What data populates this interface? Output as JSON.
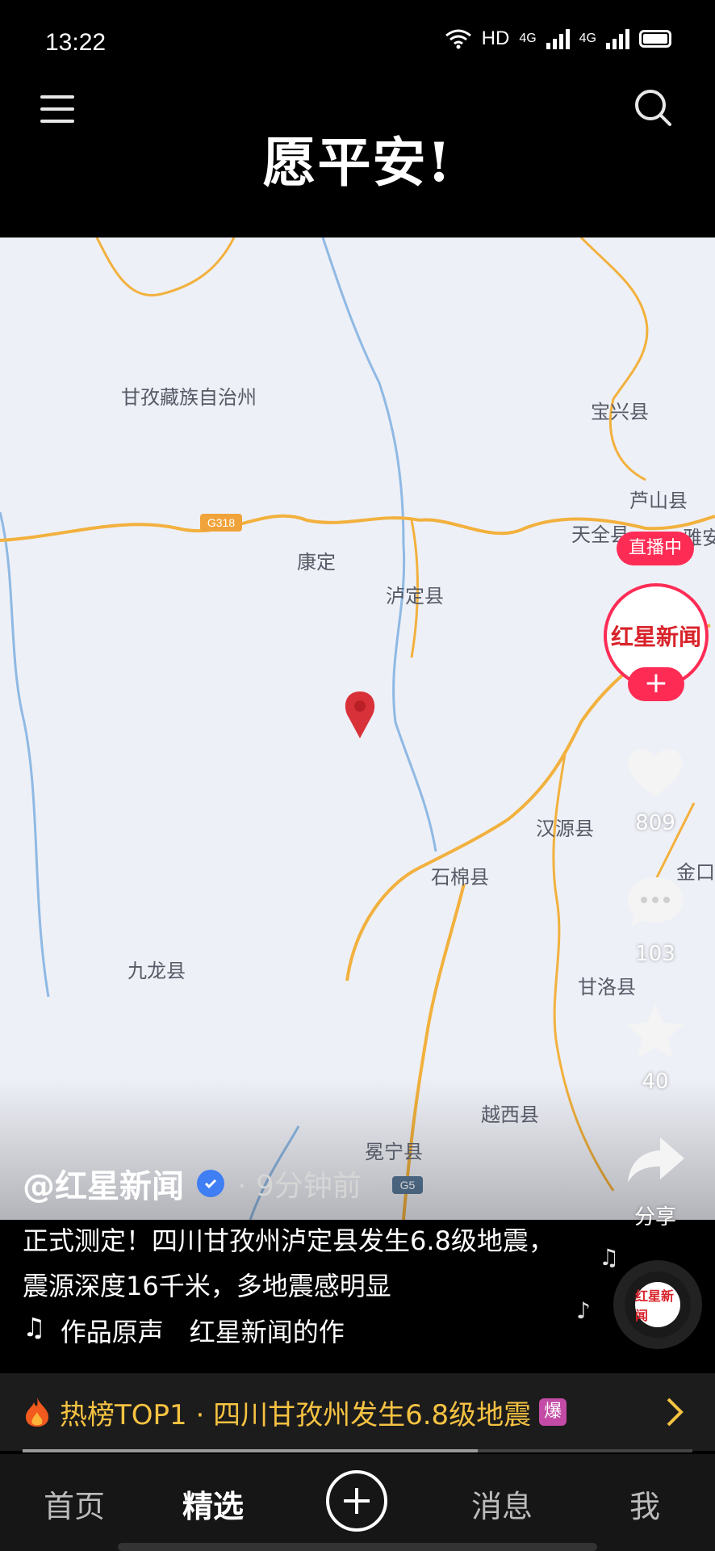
{
  "status_bar": {
    "time": "13:22",
    "network_label": "HD",
    "signal_1": "4G",
    "signal_2": "4G"
  },
  "header": {
    "video_title": "愿平安!"
  },
  "map": {
    "places": [
      "甘孜藏族自治州",
      "宝兴县",
      "芦山县",
      "天全县",
      "雅安",
      "康定",
      "泸定县",
      "汉源县",
      "石棉县",
      "金口",
      "九龙县",
      "甘洛县",
      "越西县",
      "冕宁县"
    ],
    "road_labels": [
      "G318",
      "G5"
    ],
    "marker_color": "#d9313a",
    "road_color": "#f2b13e",
    "river_color": "#8fb9e4"
  },
  "post": {
    "author": "@红星新闻",
    "time_ago": "· 9分钟前",
    "description": "正式测定！四川甘孜州泸定县发生6.8级地震，震源深度16千米，多地震感明显",
    "music": "作品原声　红星新闻的作"
  },
  "rail": {
    "live_label": "直播中",
    "avatar_label": "红星新闻",
    "likes": "809",
    "comments": "103",
    "favorites": "40",
    "share_label": "分享"
  },
  "hot": {
    "text": "热榜TOP1 · 四川甘孜州发生6.8级地震",
    "badge": "爆",
    "progress": 0.68
  },
  "nav": {
    "home": "首页",
    "featured": "精选",
    "messages": "消息",
    "me": "我"
  },
  "colors": {
    "accent": "#fe2c55",
    "hot_text": "#f5c242",
    "verified": "#3f7ef3"
  }
}
